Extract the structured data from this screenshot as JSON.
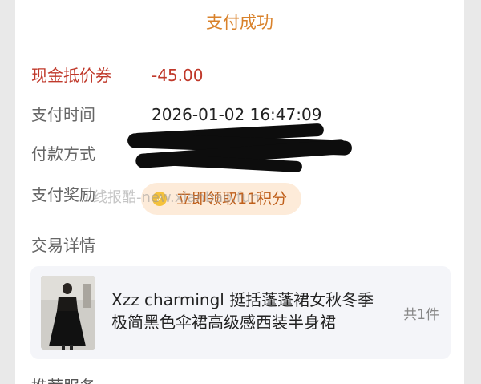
{
  "header": {
    "title": "支付成功"
  },
  "rows": {
    "coupon": {
      "label": "现金抵价券",
      "value": "-45.00"
    },
    "pay_time": {
      "label": "支付时间",
      "value": "2026-01-02 16:47:09"
    },
    "pay_method": {
      "label": "付款方式"
    },
    "reward": {
      "label": "支付奖励",
      "button_label": "立即领取11积分",
      "icon": "coin-icon"
    }
  },
  "watermark": "线报酷-new.xianbao.fun",
  "details": {
    "title": "交易详情",
    "product": {
      "name": "Xzz charmingl 挺括蓬蓬裙女秋冬季极简黑色伞裙高级感西装半身裙",
      "count": "共1件"
    }
  },
  "next_section_title": "推荐服务",
  "colors": {
    "accent": "#d9822b",
    "coupon_red": "#c0392b",
    "pill_bg": "#fdebd9"
  }
}
